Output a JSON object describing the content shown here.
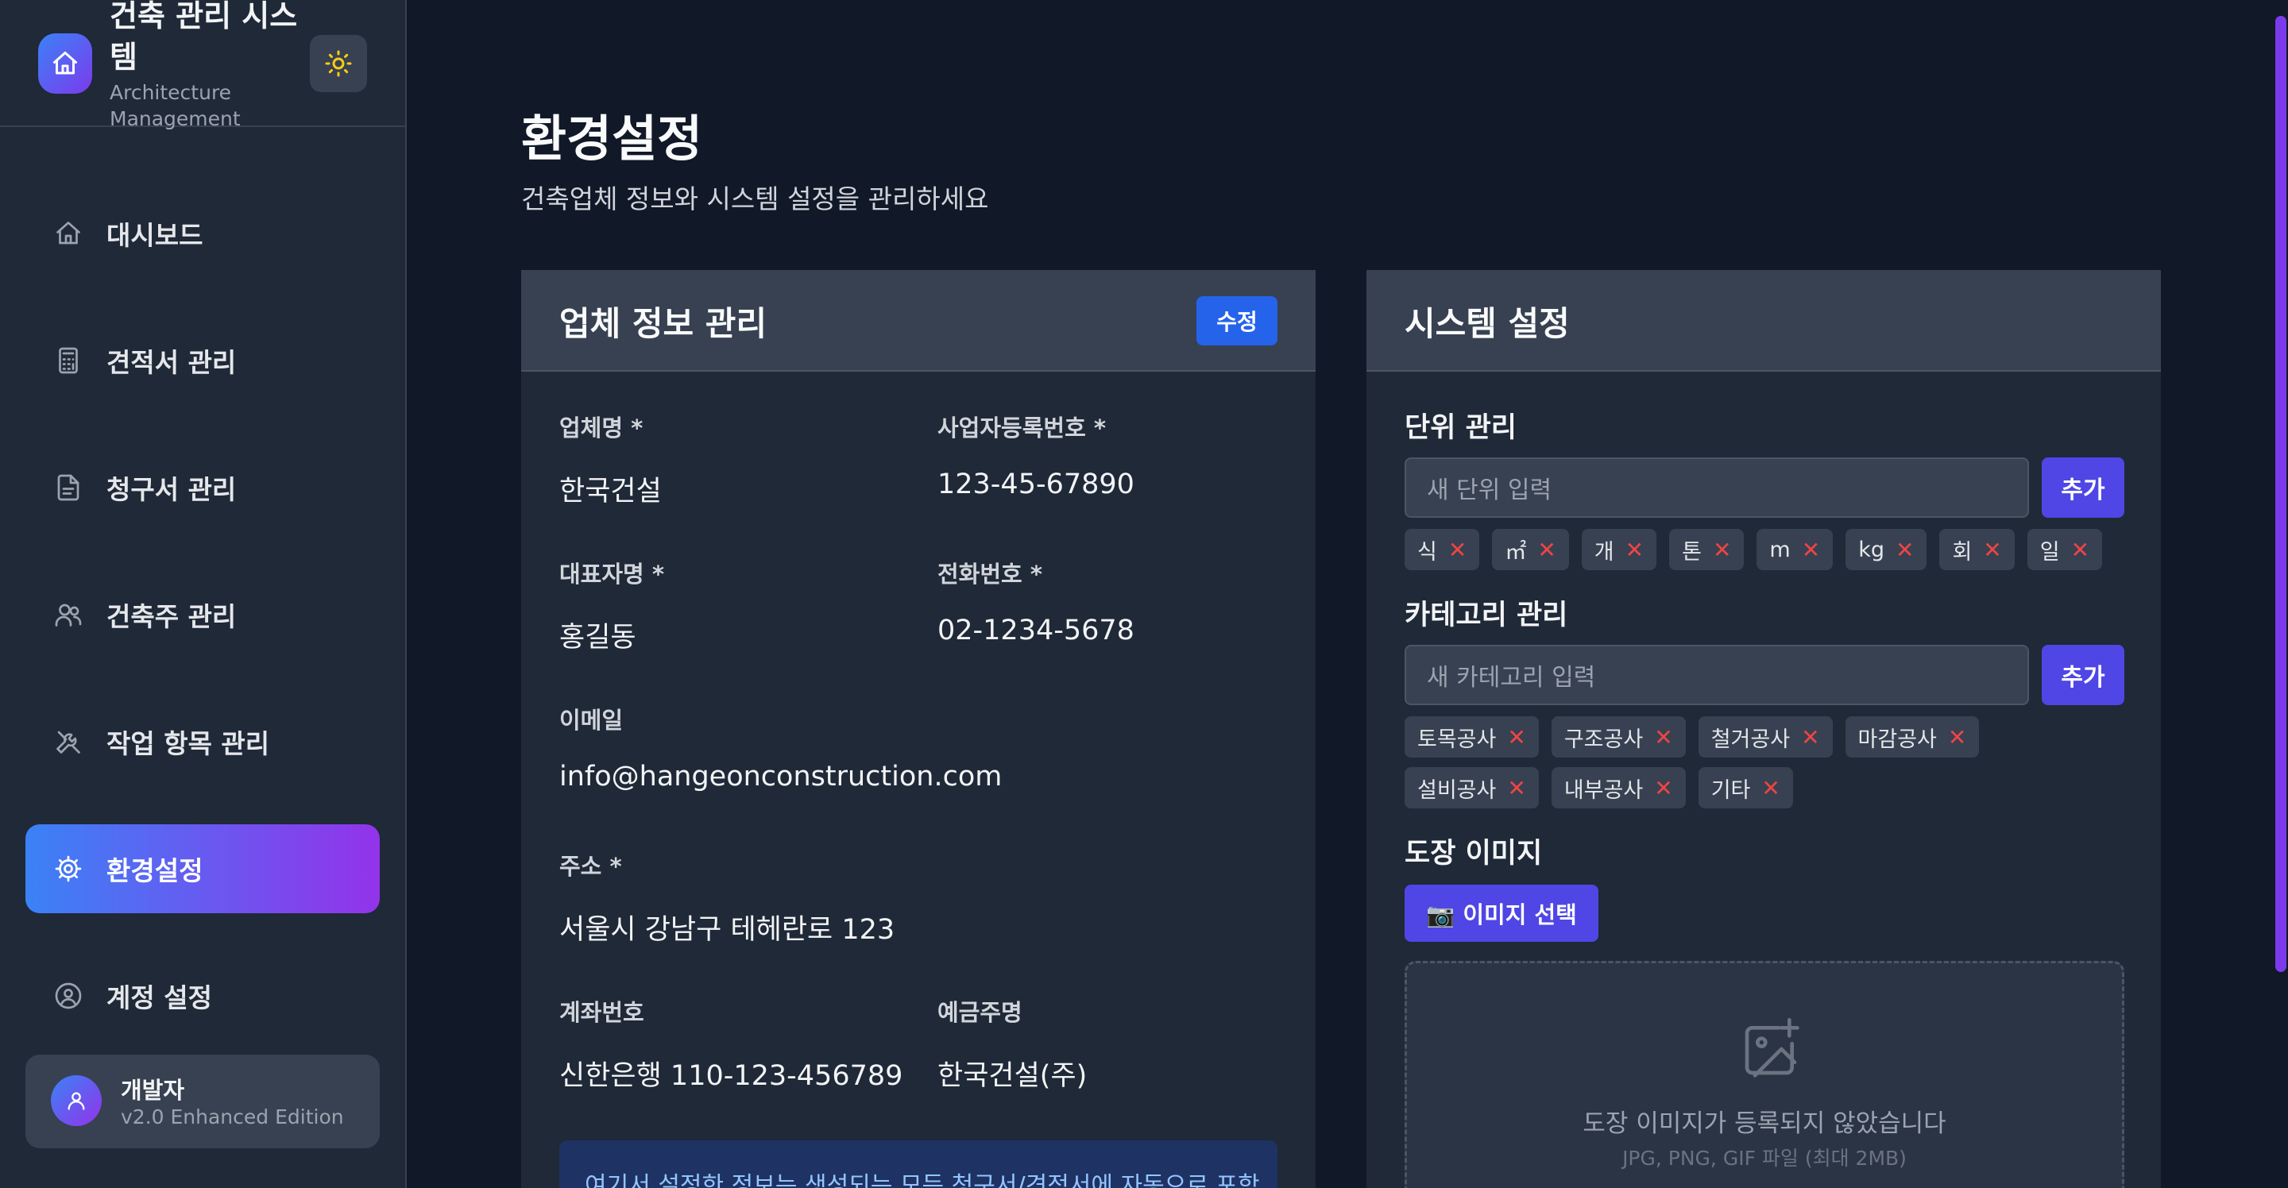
{
  "sidebar": {
    "brand": {
      "title": "건축 관리 시스템",
      "subtitle": "Architecture Management"
    },
    "theme_toggle_icon": "sun-icon",
    "items": [
      {
        "label": "대시보드",
        "icon": "home-icon",
        "active": false
      },
      {
        "label": "견적서 관리",
        "icon": "calculator-icon",
        "active": false
      },
      {
        "label": "청구서 관리",
        "icon": "file-icon",
        "active": false
      },
      {
        "label": "건축주 관리",
        "icon": "users-icon",
        "active": false
      },
      {
        "label": "작업 항목 관리",
        "icon": "tools-icon",
        "active": false
      },
      {
        "label": "환경설정",
        "icon": "gear-icon",
        "active": true
      },
      {
        "label": "계정 설정",
        "icon": "user-circle-icon",
        "active": false
      }
    ],
    "user": {
      "name": "개발자",
      "edition": "v2.0 Enhanced Edition"
    }
  },
  "page": {
    "title": "환경설정",
    "subtitle": "건축업체 정보와 시스템 설정을 관리하세요"
  },
  "company": {
    "title": "업체 정보 관리",
    "edit_label": "수정",
    "fields": {
      "name": {
        "label": "업체명 *",
        "value": "한국건설"
      },
      "biz_no": {
        "label": "사업자등록번호 *",
        "value": "123-45-67890"
      },
      "ceo": {
        "label": "대표자명 *",
        "value": "홍길동"
      },
      "phone": {
        "label": "전화번호 *",
        "value": "02-1234-5678"
      },
      "email": {
        "label": "이메일",
        "value": "info@hangeonconstruction.com"
      },
      "address": {
        "label": "주소 *",
        "value": "서울시 강남구 테헤란로 123"
      },
      "account": {
        "label": "계좌번호",
        "value": "신한은행 110-123-456789"
      },
      "holder": {
        "label": "예금주명",
        "value": "한국건설(주)"
      }
    },
    "notice": "여기서 설정한 정보는 생성되는 모든 청구서/견적서에 자동으로 포함"
  },
  "system": {
    "title": "시스템 설정",
    "units": {
      "label": "단위 관리",
      "placeholder": "새 단위 입력",
      "add_label": "추가",
      "items": [
        "식",
        "㎡",
        "개",
        "톤",
        "m",
        "kg",
        "회",
        "일"
      ]
    },
    "categories": {
      "label": "카테고리 관리",
      "placeholder": "새 카테고리 입력",
      "add_label": "추가",
      "items": [
        "토목공사",
        "구조공사",
        "철거공사",
        "마감공사",
        "설비공사",
        "내부공사",
        "기타"
      ]
    },
    "stamp": {
      "label": "도장 이미지",
      "button_label": "📷 이미지 선택",
      "empty_text": "도장 이미지가 등록되지 않았습니다",
      "hint": "JPG, PNG, GIF 파일 (최대 2MB)"
    },
    "remove_glyph": "✕"
  },
  "colors": {
    "background": "#111827",
    "sidebar": "#1f2937",
    "accent_gradient_start": "#3b82f6",
    "accent_gradient_end": "#9333ea",
    "primary_button": "#4f46e5",
    "edit_button": "#2563eb",
    "remove": "#ef4444"
  }
}
